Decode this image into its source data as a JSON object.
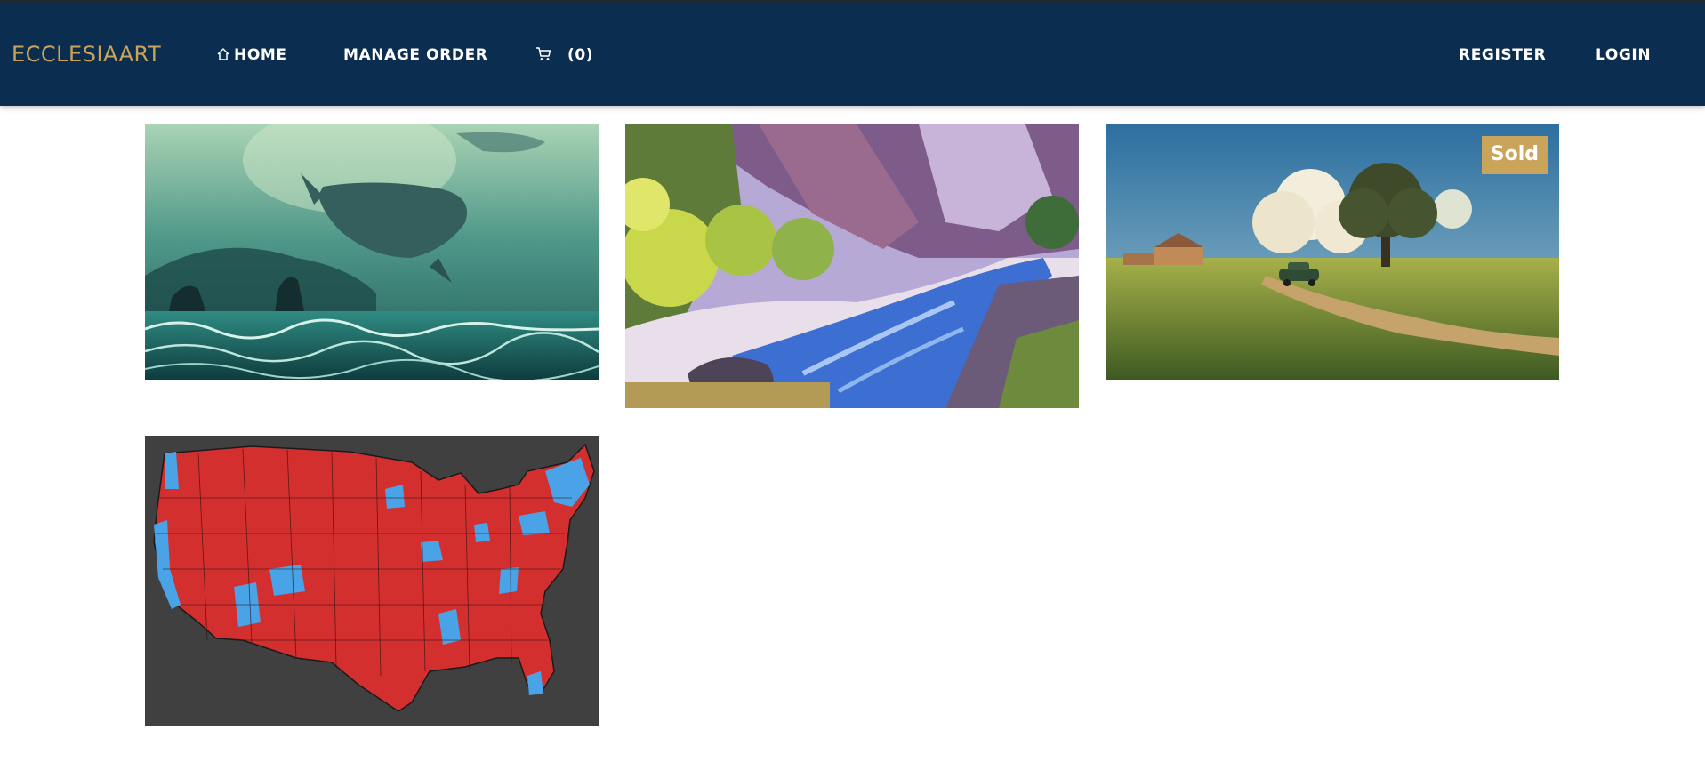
{
  "brand": {
    "name": "ECCLESIAART",
    "color": "#c9a45a"
  },
  "nav": {
    "home": {
      "label": "HOME",
      "icon": "home-icon"
    },
    "manage_order": {
      "label": "MANAGE ORDER"
    },
    "cart": {
      "icon": "cart-icon",
      "count": "(0)"
    },
    "register": {
      "label": "REGISTER"
    },
    "login": {
      "label": "LOGIN"
    }
  },
  "colors": {
    "navbar": "#0b2d4f",
    "accent": "#c9a45a",
    "page_bg": "#ffffff"
  },
  "artworks": [
    {
      "subject": "whale-over-sea-painting",
      "sold": false
    },
    {
      "subject": "mountain-river-canyon-painting",
      "sold": false
    },
    {
      "subject": "countryside-car-farm-painting",
      "sold": true,
      "badge": "Sold"
    },
    {
      "subject": "us-county-map",
      "sold": false
    }
  ]
}
